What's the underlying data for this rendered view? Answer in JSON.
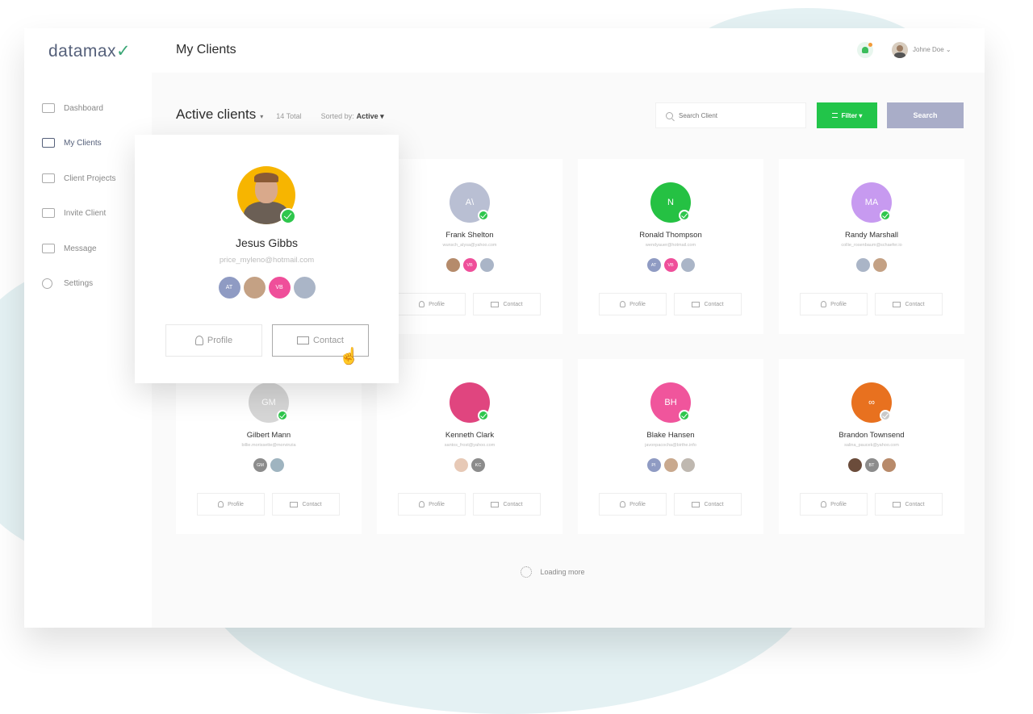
{
  "app": {
    "logo": "datamax",
    "page_title": "My Clients"
  },
  "header": {
    "user_name": "Johne Doe ⌄",
    "notification_icon": "bell-icon",
    "avatar": "user-avatar"
  },
  "sidebar": {
    "items": [
      {
        "label": "Dashboard",
        "icon": "dashboard-icon",
        "active": false
      },
      {
        "label": "My Clients",
        "icon": "clients-icon",
        "active": true
      },
      {
        "label": "Client Projects",
        "icon": "projects-icon",
        "active": false
      },
      {
        "label": "Invite Client",
        "icon": "invite-icon",
        "active": false
      },
      {
        "label": "Message",
        "icon": "envelope-icon",
        "active": false
      },
      {
        "label": "Settings",
        "icon": "gear-icon",
        "active": false
      }
    ]
  },
  "toolbar": {
    "title": "Active clients",
    "title_caret": "▾",
    "total": "14 Total",
    "sorted_label": "Sorted by:",
    "sorted_value": "Active ▾",
    "search_placeholder": "Search Client",
    "filter_label": "Filter ▾",
    "search_button": "Search"
  },
  "accent_colors": {
    "filter": "#22c54a",
    "search_button": "#a9adc8",
    "online": "#2ec64c"
  },
  "popup": {
    "name": "Jesus Gibbs",
    "email": "price_myleno@hotmail.com",
    "team": [
      {
        "initials": "AT",
        "color": "#8f9bc3"
      },
      {
        "initials": "",
        "color": "#c4a184"
      },
      {
        "initials": "VB",
        "color": "#ef4f9a"
      },
      {
        "initials": "",
        "color": "#aab5c7"
      }
    ],
    "profile_label": "Profile",
    "contact_label": "Contact"
  },
  "cards": [
    {
      "name": "Frank Shelton",
      "email": "wunsch_alysa@yahoo.com",
      "initials": "A\\",
      "color": "#b9bfd3",
      "online": true,
      "team": [
        {
          "initials": "",
          "color": "#b58b6b"
        },
        {
          "initials": "VB",
          "color": "#ef4f9a"
        },
        {
          "initials": "",
          "color": "#aab5c7"
        }
      ]
    },
    {
      "name": "Ronald Thompson",
      "email": "wendyauer@hotmail.com",
      "initials": "N",
      "color": "#25c143",
      "online": true,
      "team": [
        {
          "initials": "AT",
          "color": "#8f9bc3"
        },
        {
          "initials": "VB",
          "color": "#ef4f9a"
        },
        {
          "initials": "",
          "color": "#aab5c7"
        }
      ]
    },
    {
      "name": "Randy Marshall",
      "email": "collie_rosenbaum@schaefer.io",
      "initials": "MA",
      "color": "#c79af0",
      "online": true,
      "team": [
        {
          "initials": "",
          "color": "#aab5c7"
        },
        {
          "initials": "",
          "color": "#c4a184"
        }
      ]
    },
    {
      "name": "Gilbert Mann",
      "email": "billie.morissette@morvinzia",
      "initials": "GM",
      "color": "#d6d6d6",
      "online": true,
      "team": [
        {
          "initials": "GM",
          "color": "#8c8c8c"
        },
        {
          "initials": "",
          "color": "#9fb4c0"
        }
      ]
    },
    {
      "name": "Kenneth Clark",
      "email": "santos_frost@yahoo.com",
      "initials": "",
      "color": "#e0457f",
      "online": true,
      "team": [
        {
          "initials": "",
          "color": "#e7c9b6"
        },
        {
          "initials": "KC",
          "color": "#8c8c8c"
        }
      ]
    },
    {
      "name": "Blake Hansen",
      "email": "javonpacocha@birthe.info",
      "initials": "BH",
      "color": "#f0559c",
      "online": true,
      "team": [
        {
          "initials": "PI",
          "color": "#8f9bc3"
        },
        {
          "initials": "",
          "color": "#c9a98e"
        },
        {
          "initials": "",
          "color": "#bfb8b0"
        }
      ]
    },
    {
      "name": "Brandon Townsend",
      "email": "salina_paucek@yahoo.com",
      "initials": "∞",
      "color": "#e8711f",
      "online": false,
      "team": [
        {
          "initials": "",
          "color": "#6b4c3b"
        },
        {
          "initials": "BT",
          "color": "#8c8c8c"
        },
        {
          "initials": "",
          "color": "#b88a6a"
        }
      ]
    }
  ],
  "card_buttons": {
    "profile": "Profile",
    "contact": "Contact"
  },
  "footer": {
    "loading_text": "Loading more"
  }
}
